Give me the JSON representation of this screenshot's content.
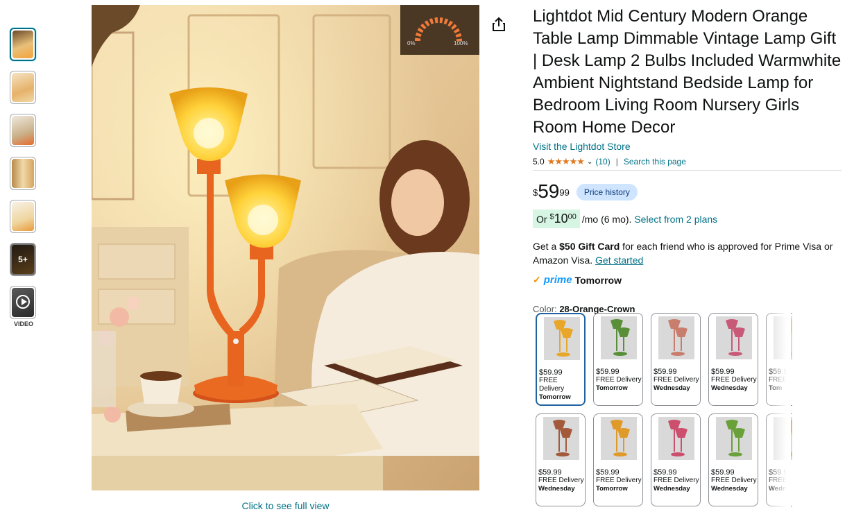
{
  "gallery": {
    "thumbnails": [
      {
        "name": "thumb-1",
        "selected": true
      },
      {
        "name": "thumb-2"
      },
      {
        "name": "thumb-3"
      },
      {
        "name": "thumb-4"
      },
      {
        "name": "thumb-5"
      },
      {
        "name": "thumb-6",
        "overlay": "5+"
      },
      {
        "name": "thumb-video"
      }
    ],
    "video_label": "VIDEO",
    "full_view_link": "Click to see full view",
    "dimmer_left": "0%",
    "dimmer_right": "100%"
  },
  "product": {
    "title": "Lightdot Mid Century Modern Orange Table Lamp Dimmable Vintage Lamp Gift | Desk Lamp 2 Bulbs Included Warmwhite Ambient Nightstand Bedside Lamp for Bedroom Living Room Nursery Girls Room Home Decor",
    "store_link": "Visit the Lightdot Store",
    "rating": "5.0",
    "stars": "★★★★★",
    "review_count": "(10)",
    "search_page": "Search this page",
    "price_symbol": "$",
    "price_whole": "59",
    "price_fraction": "99",
    "price_history": "Price history",
    "monthly_or": "Or",
    "monthly_symbol": "$",
    "monthly_whole": "10",
    "monthly_fraction": "00",
    "monthly_term": "/mo (6 mo).",
    "monthly_plans": "Select from 2 plans",
    "gift_prefix": "Get a",
    "gift_amount": "$50 Gift Card",
    "gift_suffix": "for each friend who is approved for Prime Visa or Amazon Visa.",
    "gift_link": "Get started",
    "prime_logo": "prime",
    "prime_delivery": "Tomorrow",
    "color_label": "Color:",
    "color_value": "28-Orange-Crown"
  },
  "swatches": [
    {
      "price": "$59.99",
      "delivery": "FREE Delivery",
      "day": "Tomorrow",
      "color": "#e8a72a",
      "selected": true
    },
    {
      "price": "$59.99",
      "delivery": "FREE Delivery",
      "day": "Tomorrow",
      "color": "#5a8f3a"
    },
    {
      "price": "$59.99",
      "delivery": "FREE Delivery",
      "day": "Wednesday",
      "color": "#c97d6c"
    },
    {
      "price": "$59.99",
      "delivery": "FREE Delivery",
      "day": "Wednesday",
      "color": "#c85a78"
    },
    {
      "price": "$59.9",
      "delivery": "FREE",
      "day": "Tom",
      "color": "#e7c9a0"
    },
    {
      "price": "$59.99",
      "delivery": "FREE Delivery",
      "day": "Wednesday",
      "color": "#a35a3a"
    },
    {
      "price": "$59.99",
      "delivery": "FREE Delivery",
      "day": "Tomorrow",
      "color": "#e09a2a"
    },
    {
      "price": "$59.99",
      "delivery": "FREE Delivery",
      "day": "Wednesday",
      "color": "#cc4f6d"
    },
    {
      "price": "$59.99",
      "delivery": "FREE Delivery",
      "day": "Wednesday",
      "color": "#6aa03a"
    },
    {
      "price": "$59.9",
      "delivery": "FREE",
      "day": "Wedn",
      "color": "#e8b85a"
    }
  ]
}
